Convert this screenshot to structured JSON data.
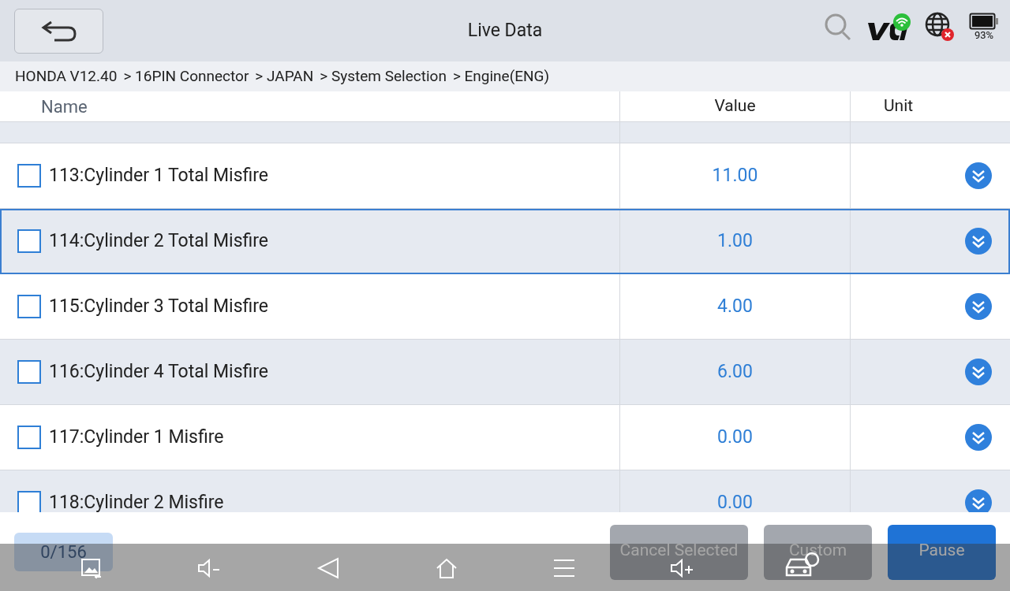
{
  "header": {
    "title": "Live Data",
    "battery": "93%"
  },
  "breadcrumb": [
    "HONDA V12.40",
    "> 16PIN Connector",
    "> JAPAN",
    "> System Selection",
    "> Engine(ENG)"
  ],
  "table": {
    "columns": [
      "Name",
      "Value",
      "Unit"
    ],
    "rows": [
      {
        "name": "113:Cylinder 1 Total Misfire",
        "value": "11.00",
        "checked": false,
        "selected": false
      },
      {
        "name": "114:Cylinder 2 Total Misfire",
        "value": "1.00",
        "checked": false,
        "selected": true
      },
      {
        "name": "115:Cylinder 3 Total Misfire",
        "value": "4.00",
        "checked": false,
        "selected": false
      },
      {
        "name": "116:Cylinder 4 Total Misfire",
        "value": "6.00",
        "checked": false,
        "selected": false
      },
      {
        "name": "117:Cylinder 1 Misfire",
        "value": "0.00",
        "checked": false,
        "selected": false
      },
      {
        "name": "118:Cylinder 2 Misfire",
        "value": "0.00",
        "checked": false,
        "selected": false
      }
    ]
  },
  "counter": "0/156",
  "buttons": [
    {
      "label": "Cancel Selected",
      "kind": "secondary"
    },
    {
      "label": "Custom",
      "kind": "secondary"
    },
    {
      "label": "Pause",
      "kind": "primary"
    }
  ]
}
